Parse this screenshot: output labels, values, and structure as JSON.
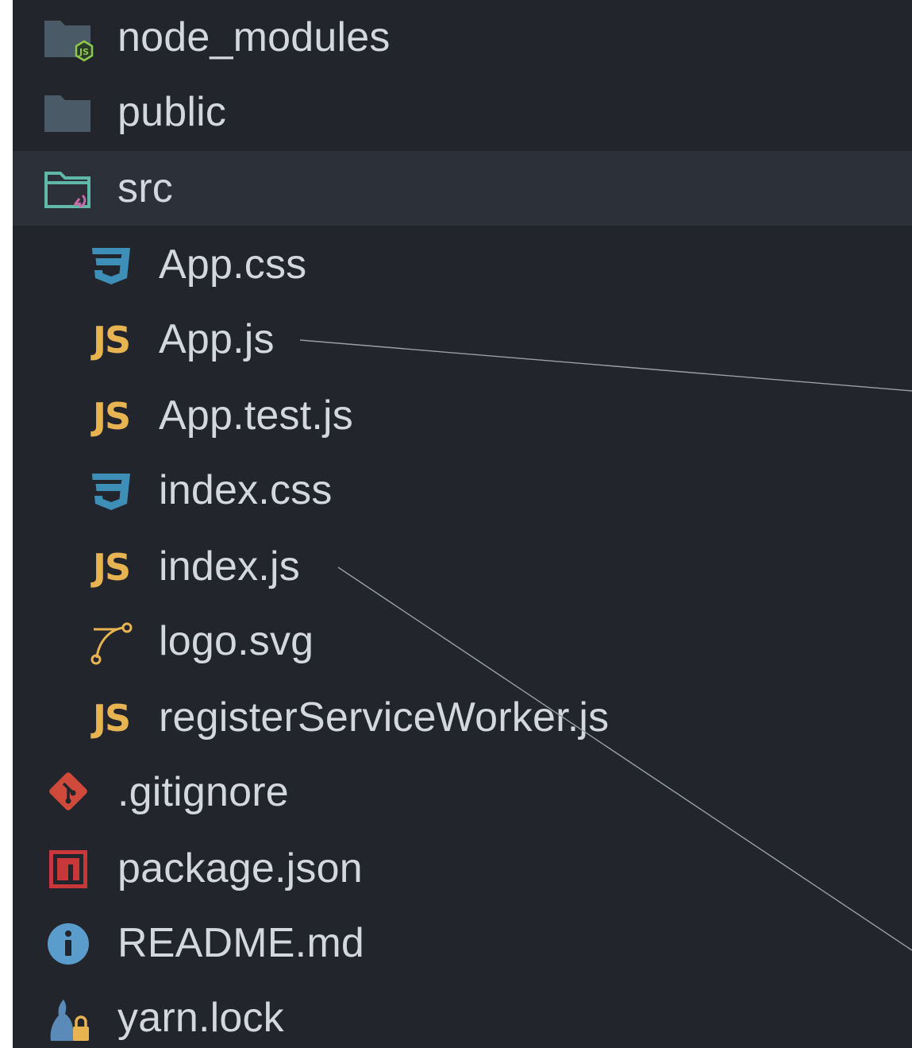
{
  "file_tree": {
    "items": [
      {
        "name": "node_modules",
        "icon": "node-modules-folder-icon",
        "level": 0,
        "selected": false
      },
      {
        "name": "public",
        "icon": "folder-icon",
        "level": 0,
        "selected": false
      },
      {
        "name": "src",
        "icon": "open-folder-icon",
        "level": 0,
        "selected": true
      },
      {
        "name": "App.css",
        "icon": "css3-icon",
        "level": 1,
        "selected": false
      },
      {
        "name": "App.js",
        "icon": "javascript-icon",
        "level": 1,
        "selected": false
      },
      {
        "name": "App.test.js",
        "icon": "javascript-icon",
        "level": 1,
        "selected": false
      },
      {
        "name": "index.css",
        "icon": "css3-icon",
        "level": 1,
        "selected": false
      },
      {
        "name": "index.js",
        "icon": "javascript-icon",
        "level": 1,
        "selected": false
      },
      {
        "name": "logo.svg",
        "icon": "vector-path-icon",
        "level": 1,
        "selected": false
      },
      {
        "name": "registerServiceWorker.js",
        "icon": "javascript-icon",
        "level": 1,
        "selected": false
      },
      {
        "name": ".gitignore",
        "icon": "git-icon",
        "level": 0,
        "selected": false
      },
      {
        "name": "package.json",
        "icon": "npm-icon",
        "level": 0,
        "selected": false
      },
      {
        "name": "README.md",
        "icon": "info-icon",
        "level": 0,
        "selected": false
      },
      {
        "name": "yarn.lock",
        "icon": "yarn-lock-icon",
        "level": 0,
        "selected": false
      }
    ],
    "js_glyph": "JS"
  },
  "colors": {
    "panel_background": "#22252c",
    "selected_row": "#2c3038",
    "text": "#d3d7de",
    "folder": "#4a5a66",
    "open_folder": "#5fb8a8",
    "css": "#3d8fb8",
    "javascript": "#e8b451",
    "git": "#d04a3c",
    "npm": "#c8373a",
    "info": "#5a9ccc",
    "yarn": "#5a8ab8"
  }
}
